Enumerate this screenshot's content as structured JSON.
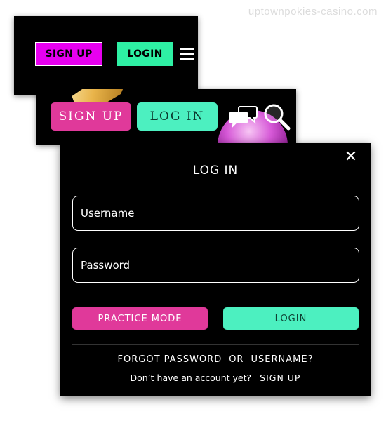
{
  "watermark": "uptownpokies-casino.com",
  "colors": {
    "magenta": "#e700f0",
    "green": "#2ef0a4",
    "pink": "#e0399a",
    "mint": "#4cf0c0",
    "background": "#000000"
  },
  "header_primary": {
    "signup_label": "SIGN UP",
    "login_label": "LOGIN",
    "menu_icon": "hamburger-menu-icon"
  },
  "header_secondary": {
    "signup_label": "SIGN UP",
    "login_label": "LOG IN",
    "chat_icon": "chat-bubbles-icon",
    "search_icon": "search-icon"
  },
  "login_modal": {
    "title": "LOG IN",
    "close_icon": "close-icon",
    "username_placeholder": "Username",
    "password_placeholder": "Password",
    "practice_label": "PRACTICE MODE",
    "login_label": "LOGIN",
    "forgot_password": "FORGOT PASSWORD",
    "or": "OR",
    "username_link": "USERNAME?",
    "no_account": "Don’t have an account yet?",
    "signup_link": "SIGN UP"
  }
}
